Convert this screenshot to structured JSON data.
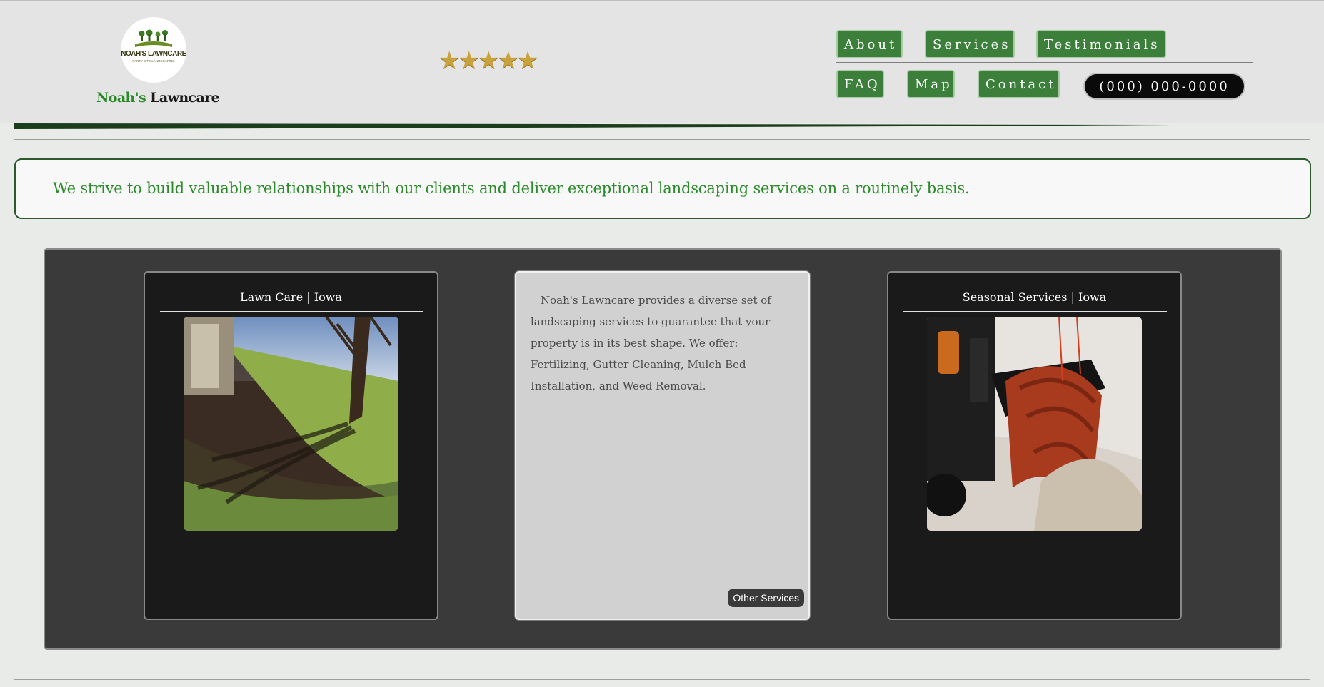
{
  "brand": {
    "logo_text": "NOAH'S LAWNCARE",
    "logo_subtext": "PARTY SITE LANDSCAPING",
    "name_first": "Noah's",
    "name_second": "Lawncare"
  },
  "rating": {
    "stars": "★★★★★",
    "value": 5,
    "max": 5
  },
  "nav": {
    "about": "About",
    "services": "Services",
    "testimonials": "Testimonials",
    "faq": "FAQ",
    "map": "Map",
    "contact": "Contact",
    "phone": "(000) 000-0000"
  },
  "tagline": "We strive to build valuable relationships with our clients and deliver exceptional landscaping services on a routinely basis.",
  "cards": {
    "lawn_care": {
      "title": "Lawn Care | Iowa"
    },
    "description": {
      "text": "Noah's Lawncare provides a diverse set of landscaping services to guarantee that your property is in its best shape. We offer: Fertilizing, Gutter Cleaning, Mulch Bed Installation, and Weed Removal.",
      "button": "Other Services"
    },
    "seasonal": {
      "title": "Seasonal Services | Iowa"
    }
  },
  "colors": {
    "brand_green": "#3b7f3a",
    "text_green": "#2d8a2d",
    "star_gold": "#c9a23b",
    "panel_dark": "#3a3a3a"
  }
}
